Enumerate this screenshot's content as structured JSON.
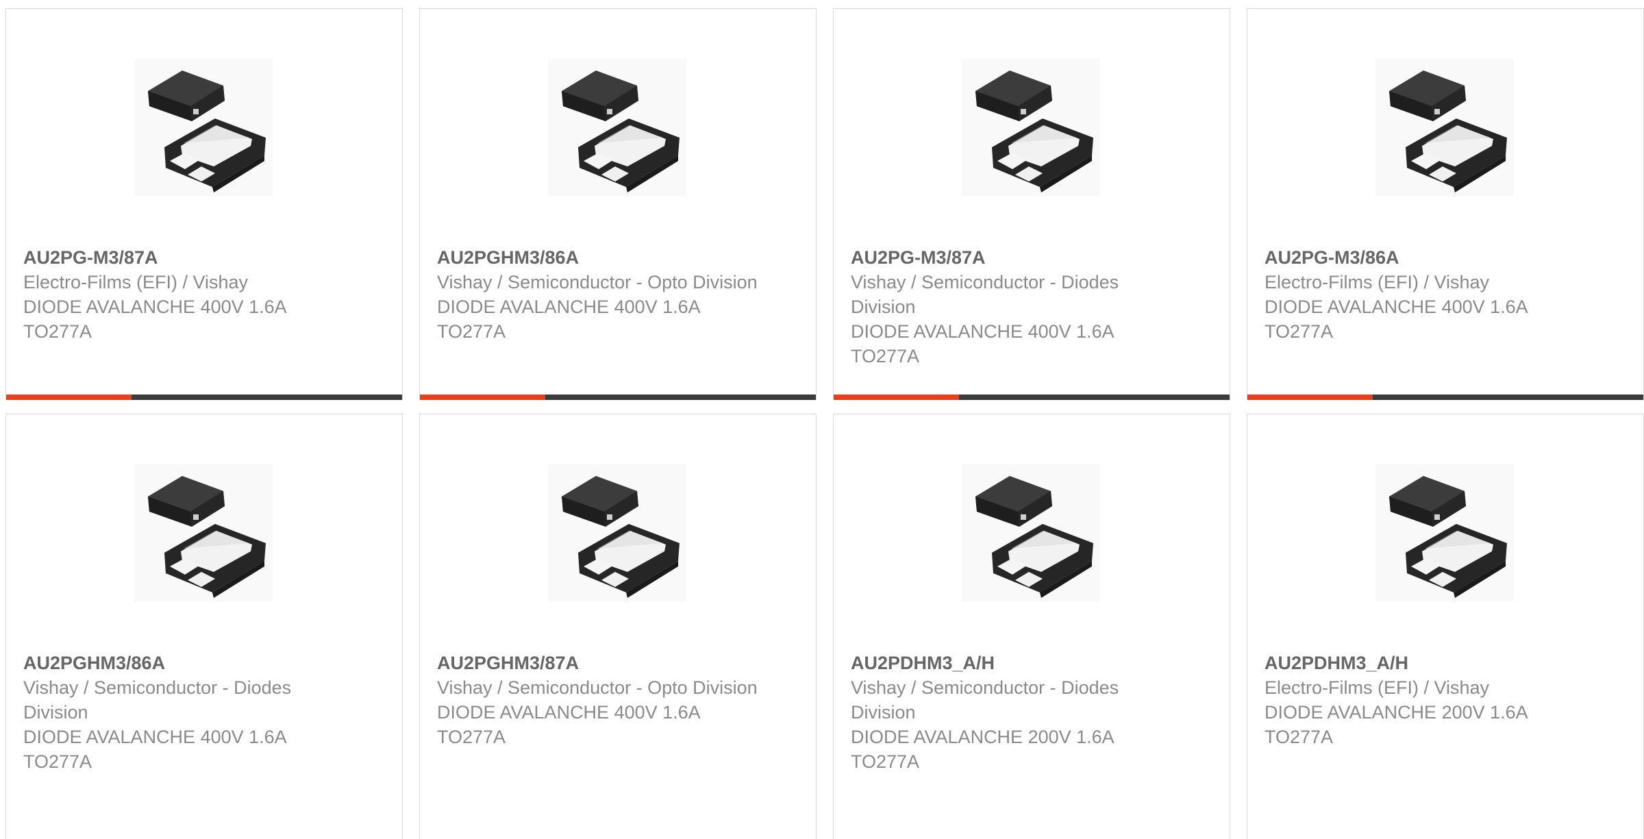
{
  "colors": {
    "accent": "#e8401c",
    "bar_dark": "#3b3b3b",
    "part_number": "#666666",
    "text": "#8a8a8a",
    "border": "#d9d9d9"
  },
  "products": [
    {
      "part_number": "AU2PG-M3/87A",
      "manufacturer": "Electro-Films (EFI) / Vishay",
      "description": "DIODE AVALANCHE 400V 1.6A",
      "package": "TO277A",
      "image_icon": "diode-package-image"
    },
    {
      "part_number": "AU2PGHM3/86A",
      "manufacturer": "Vishay / Semiconductor - Opto Division",
      "description": "DIODE AVALANCHE 400V 1.6A",
      "package": "TO277A",
      "image_icon": "diode-package-image"
    },
    {
      "part_number": "AU2PG-M3/87A",
      "manufacturer": "Vishay / Semiconductor - Diodes Division",
      "description": "DIODE AVALANCHE 400V 1.6A",
      "package": "TO277A",
      "image_icon": "diode-package-image"
    },
    {
      "part_number": "AU2PG-M3/86A",
      "manufacturer": "Electro-Films (EFI) / Vishay",
      "description": "DIODE AVALANCHE 400V 1.6A",
      "package": "TO277A",
      "image_icon": "diode-package-image"
    },
    {
      "part_number": "AU2PGHM3/86A",
      "manufacturer": "Vishay / Semiconductor - Diodes Division",
      "description": "DIODE AVALANCHE 400V 1.6A",
      "package": "TO277A",
      "image_icon": "diode-package-image"
    },
    {
      "part_number": "AU2PGHM3/87A",
      "manufacturer": "Vishay / Semiconductor - Opto Division",
      "description": "DIODE AVALANCHE 400V 1.6A",
      "package": "TO277A",
      "image_icon": "diode-package-image"
    },
    {
      "part_number": "AU2PDHM3_A/H",
      "manufacturer": "Vishay / Semiconductor - Diodes Division",
      "description": "DIODE AVALANCHE 200V 1.6A",
      "package": "TO277A",
      "image_icon": "diode-package-image"
    },
    {
      "part_number": "AU2PDHM3_A/H",
      "manufacturer": "Electro-Films (EFI) / Vishay",
      "description": "DIODE AVALANCHE 200V 1.6A",
      "package": "TO277A",
      "image_icon": "diode-package-image"
    }
  ]
}
